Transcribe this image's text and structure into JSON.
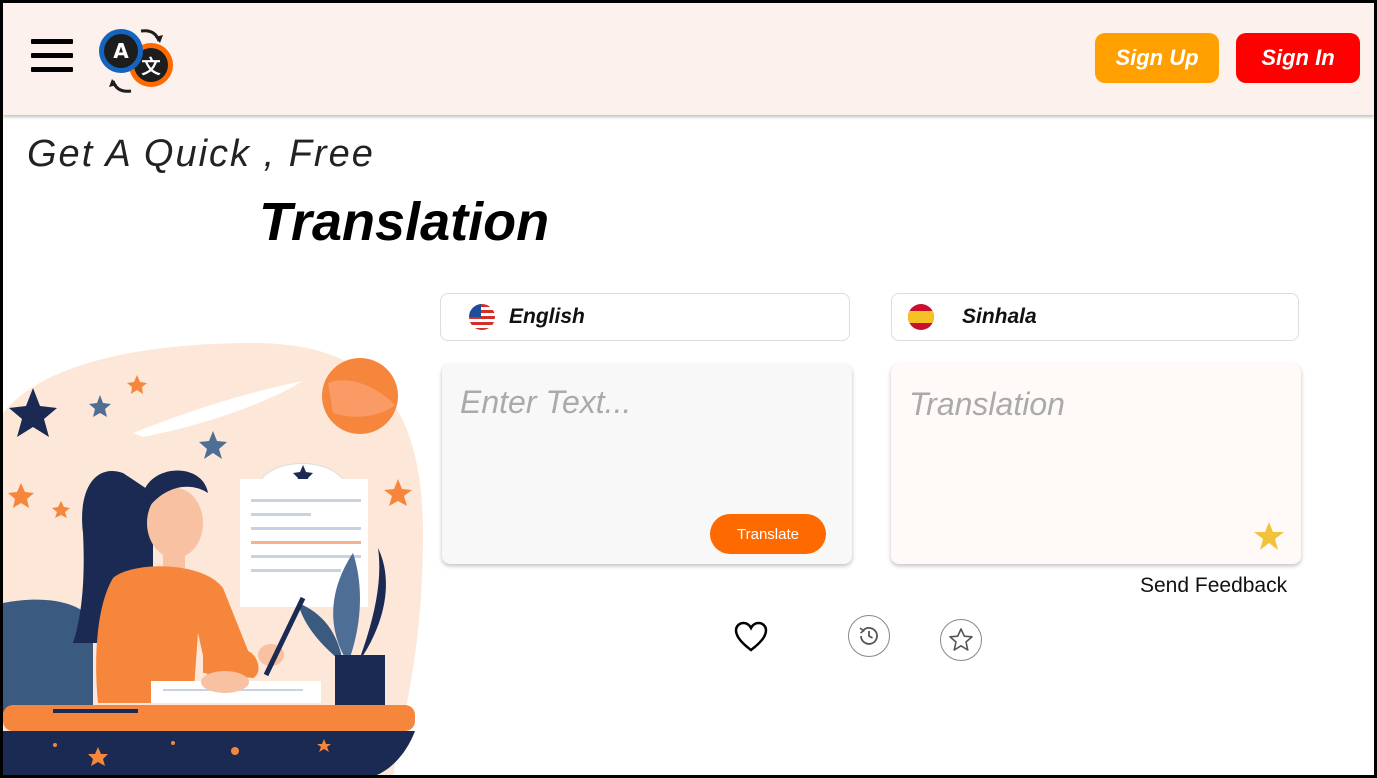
{
  "header": {
    "menu_icon": "hamburger-menu-icon",
    "logo_icon": "translate-logo-icon",
    "signup_label": "Sign Up",
    "signin_label": "Sign In"
  },
  "hero": {
    "tagline": "Get A Quick , Free",
    "headline": "Translation"
  },
  "source": {
    "language": "English",
    "flag": "us-flag-icon",
    "placeholder": "Enter Text...",
    "translate_label": "Translate"
  },
  "target": {
    "language": "Sinhala",
    "flag": "spain-flag-icon",
    "placeholder": "Translation",
    "star_icon": "star-icon"
  },
  "feedback_label": "Send Feedback",
  "actions": [
    "heart-icon",
    "history-icon",
    "saved-star-icon"
  ],
  "colors": {
    "header_bg": "#fcf1ec",
    "signup": "#ff9f00",
    "signin": "#ff0000",
    "translate": "#ff6a00",
    "star": "#f2c23a"
  }
}
